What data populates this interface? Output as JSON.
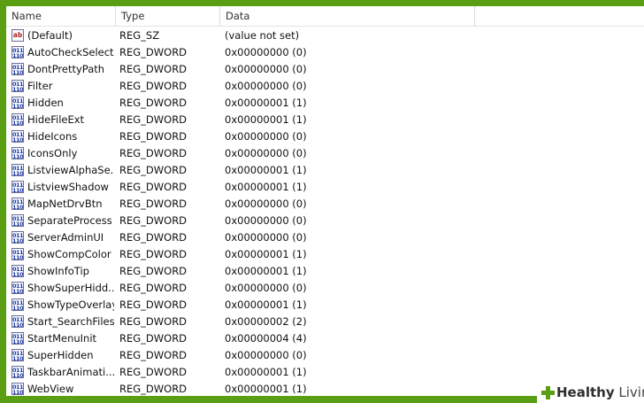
{
  "columns": {
    "name": "Name",
    "type": "Type",
    "data": "Data"
  },
  "rows": [
    {
      "name": "(Default)",
      "type": "REG_SZ",
      "data": "(value not set)",
      "icon": "string-value-icon"
    },
    {
      "name": "AutoCheckSelect",
      "type": "REG_DWORD",
      "data": "0x00000000 (0)",
      "icon": "binary-value-icon"
    },
    {
      "name": "DontPrettyPath",
      "type": "REG_DWORD",
      "data": "0x00000000 (0)",
      "icon": "binary-value-icon"
    },
    {
      "name": "Filter",
      "type": "REG_DWORD",
      "data": "0x00000000 (0)",
      "icon": "binary-value-icon"
    },
    {
      "name": "Hidden",
      "type": "REG_DWORD",
      "data": "0x00000001 (1)",
      "icon": "binary-value-icon"
    },
    {
      "name": "HideFileExt",
      "type": "REG_DWORD",
      "data": "0x00000001 (1)",
      "icon": "binary-value-icon"
    },
    {
      "name": "HideIcons",
      "type": "REG_DWORD",
      "data": "0x00000000 (0)",
      "icon": "binary-value-icon"
    },
    {
      "name": "IconsOnly",
      "type": "REG_DWORD",
      "data": "0x00000000 (0)",
      "icon": "binary-value-icon"
    },
    {
      "name": "ListviewAlphaSe...",
      "type": "REG_DWORD",
      "data": "0x00000001 (1)",
      "icon": "binary-value-icon"
    },
    {
      "name": "ListviewShadow",
      "type": "REG_DWORD",
      "data": "0x00000001 (1)",
      "icon": "binary-value-icon"
    },
    {
      "name": "MapNetDrvBtn",
      "type": "REG_DWORD",
      "data": "0x00000000 (0)",
      "icon": "binary-value-icon"
    },
    {
      "name": "SeparateProcess",
      "type": "REG_DWORD",
      "data": "0x00000000 (0)",
      "icon": "binary-value-icon"
    },
    {
      "name": "ServerAdminUI",
      "type": "REG_DWORD",
      "data": "0x00000000 (0)",
      "icon": "binary-value-icon"
    },
    {
      "name": "ShowCompColor",
      "type": "REG_DWORD",
      "data": "0x00000001 (1)",
      "icon": "binary-value-icon"
    },
    {
      "name": "ShowInfoTip",
      "type": "REG_DWORD",
      "data": "0x00000001 (1)",
      "icon": "binary-value-icon"
    },
    {
      "name": "ShowSuperHidd...",
      "type": "REG_DWORD",
      "data": "0x00000000 (0)",
      "icon": "binary-value-icon"
    },
    {
      "name": "ShowTypeOverlay",
      "type": "REG_DWORD",
      "data": "0x00000001 (1)",
      "icon": "binary-value-icon"
    },
    {
      "name": "Start_SearchFiles",
      "type": "REG_DWORD",
      "data": "0x00000002 (2)",
      "icon": "binary-value-icon"
    },
    {
      "name": "StartMenuInit",
      "type": "REG_DWORD",
      "data": "0x00000004 (4)",
      "icon": "binary-value-icon"
    },
    {
      "name": "SuperHidden",
      "type": "REG_DWORD",
      "data": "0x00000000 (0)",
      "icon": "binary-value-icon"
    },
    {
      "name": "TaskbarAnimati...",
      "type": "REG_DWORD",
      "data": "0x00000001 (1)",
      "icon": "binary-value-icon"
    },
    {
      "name": "WebView",
      "type": "REG_DWORD",
      "data": "0x00000001 (1)",
      "icon": "binary-value-icon"
    }
  ],
  "icon_glyphs": {
    "string": "ab",
    "binary_top": "011",
    "binary_bottom": "110"
  },
  "watermark": {
    "part1": "Healthy",
    "part2": " Living",
    "icon": "plus-cross-icon"
  },
  "colors": {
    "frame": "#5a9e14",
    "brand": "#5a9e14",
    "string_icon": "#b22222",
    "binary_icon": "#1c3aa8"
  }
}
